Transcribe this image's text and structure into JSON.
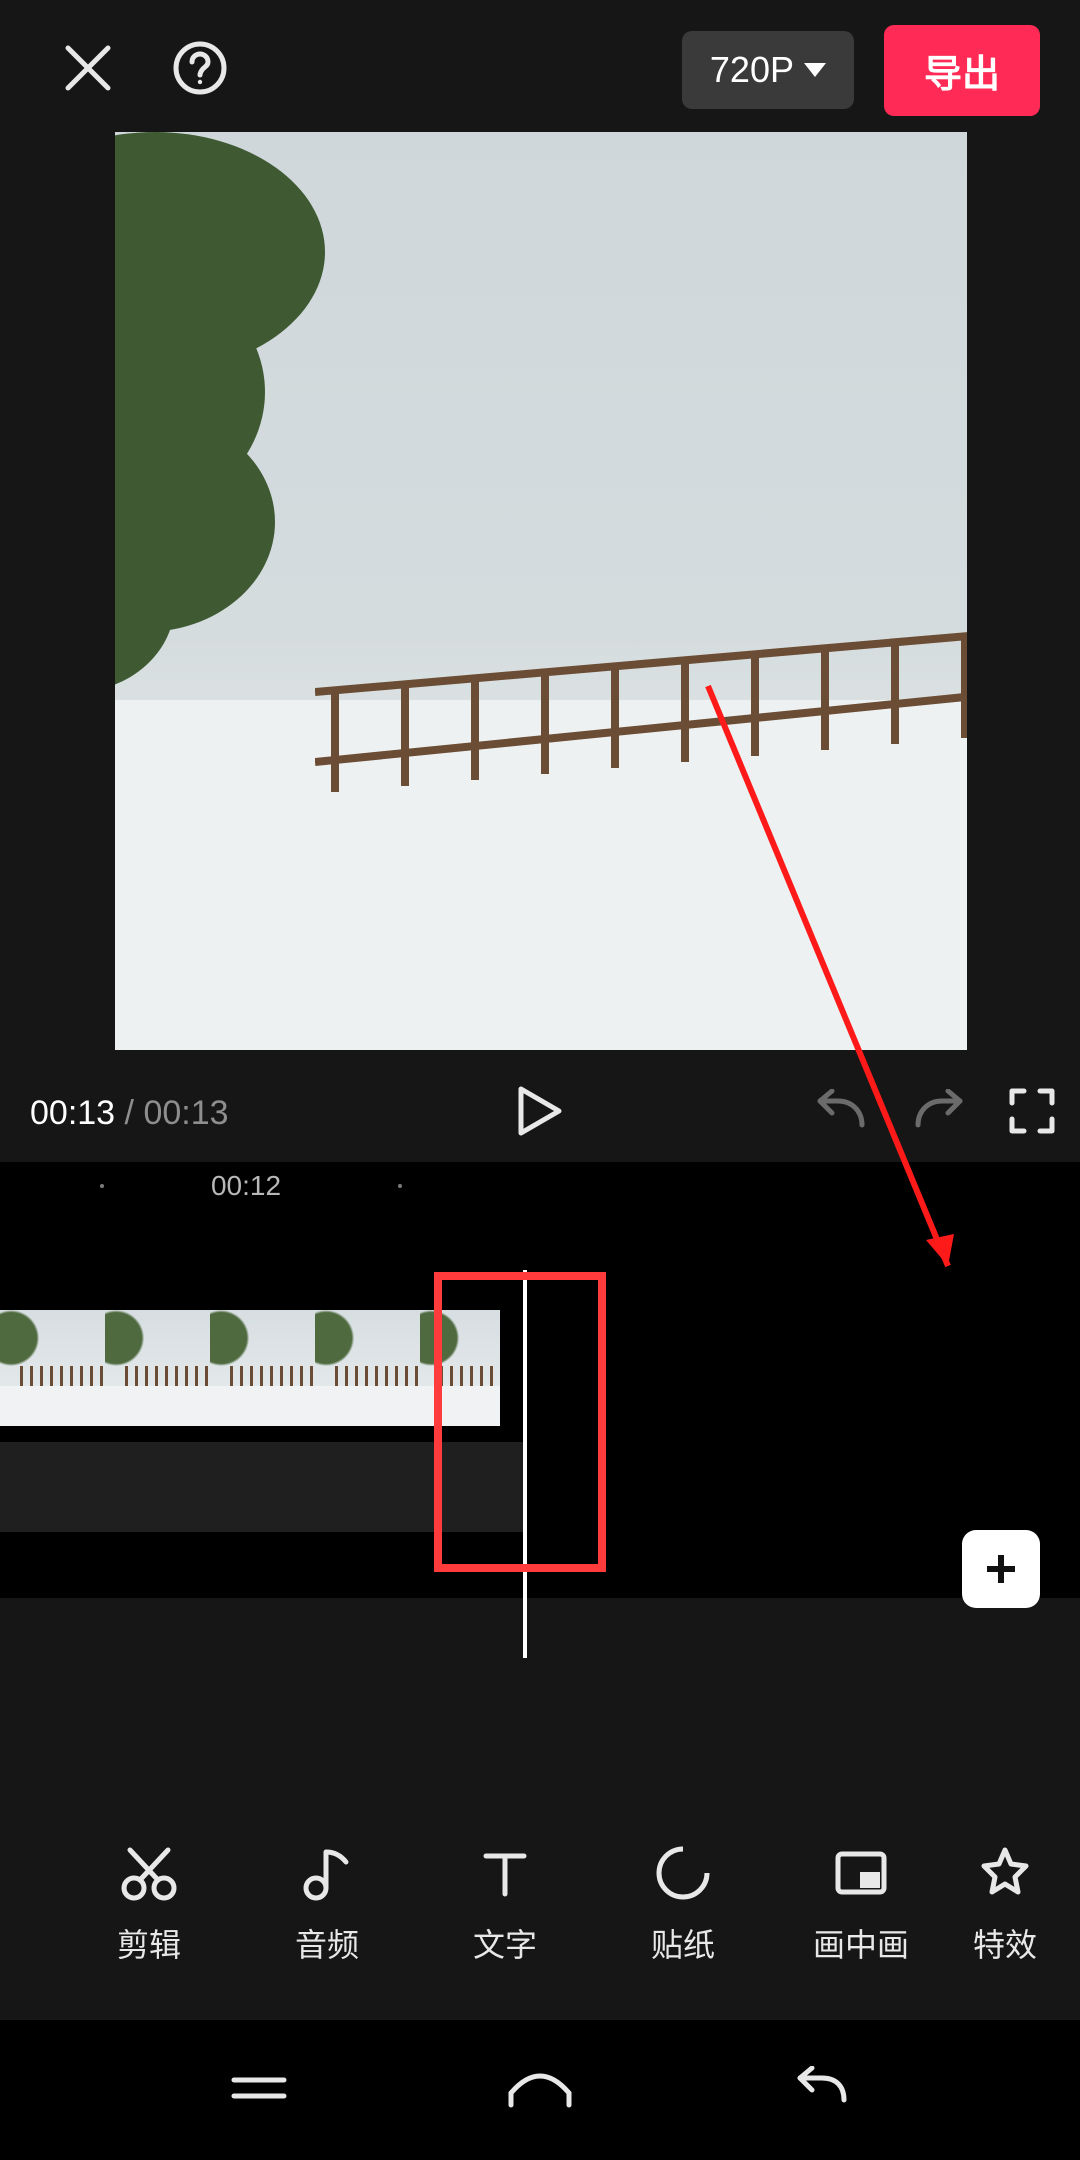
{
  "header": {
    "resolution_label": "720P",
    "export_label": "导出"
  },
  "playback": {
    "current_time": "00:13",
    "separator": " / ",
    "duration": "00:13"
  },
  "timeline": {
    "ruler_label": "00:12"
  },
  "toolbar": {
    "items": [
      {
        "id": "edit",
        "label": "剪辑",
        "icon": "scissors-icon"
      },
      {
        "id": "audio",
        "label": "音频",
        "icon": "music-note-icon"
      },
      {
        "id": "text",
        "label": "文字",
        "icon": "text-icon"
      },
      {
        "id": "sticker",
        "label": "贴纸",
        "icon": "sticker-icon"
      },
      {
        "id": "pip",
        "label": "画中画",
        "icon": "picture-in-picture-icon"
      },
      {
        "id": "effects",
        "label": "特效",
        "icon": "star-icon"
      }
    ]
  }
}
